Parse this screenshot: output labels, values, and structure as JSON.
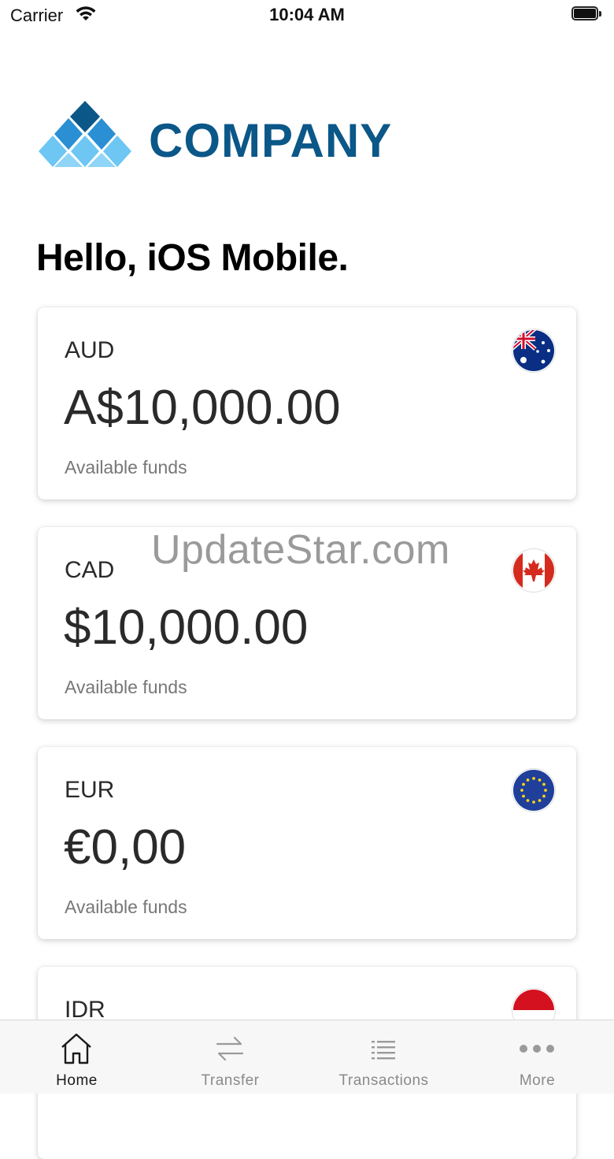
{
  "status_bar": {
    "carrier": "Carrier",
    "time": "10:04 AM"
  },
  "logo": {
    "text": "COMPANY",
    "color": "#0b5788"
  },
  "greeting": "Hello, iOS Mobile.",
  "accounts": [
    {
      "code": "AUD",
      "amount": "A$10,000.00",
      "label": "Available funds",
      "flag_icon": "australia-flag-icon"
    },
    {
      "code": "CAD",
      "amount": "$10,000.00",
      "label": "Available funds",
      "flag_icon": "canada-flag-icon"
    },
    {
      "code": "EUR",
      "amount": "€0,00",
      "label": "Available funds",
      "flag_icon": "eu-flag-icon"
    },
    {
      "code": "IDR",
      "flag_icon": "indonesia-flag-icon"
    }
  ],
  "watermark": "UpdateStar.com",
  "tab_bar": {
    "tabs": [
      {
        "label": "Home",
        "icon": "home-icon",
        "active": true
      },
      {
        "label": "Transfer",
        "icon": "transfer-icon",
        "active": false
      },
      {
        "label": "Transactions",
        "icon": "list-icon",
        "active": false
      },
      {
        "label": "More",
        "icon": "more-dots-icon",
        "active": false
      }
    ]
  }
}
